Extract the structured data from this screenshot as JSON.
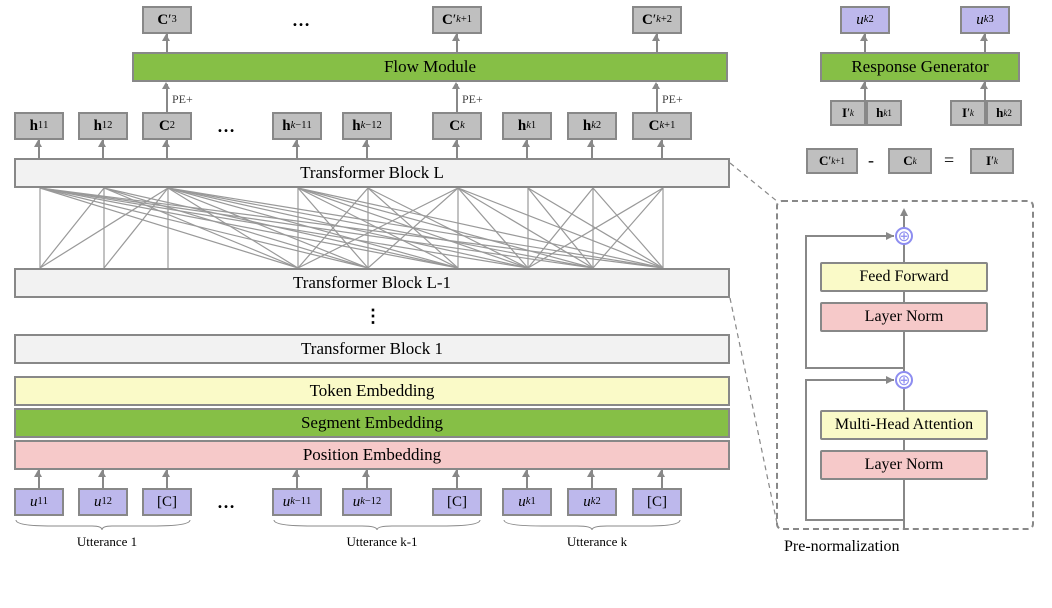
{
  "left": {
    "flow_label": "Flow Module",
    "pe_label": "PE+",
    "transformer_L": "Transformer Block L",
    "transformer_Lm1": "Transformer Block L-1",
    "transformer_1": "Transformer Block 1",
    "token_emb": "Token Embedding",
    "segment_emb": "Segment Embedding",
    "position_emb": "Position Embedding",
    "utt1": "Utterance 1",
    "uttkm1": "Utterance k-1",
    "uttk": "Utterance k",
    "dots": "…",
    "vdots": "⋮",
    "outputs": [
      {
        "html": "<b>C</b>′<sub>3</sub>"
      },
      {
        "html": "<b>C</b>′<sub><span class='mvar'>k</span>+1</sub>"
      },
      {
        "html": "<b>C</b>′<sub><span class='mvar'>k</span>+2</sub>"
      }
    ],
    "hidden_row": [
      {
        "html": "<b>h</b><sub>1</sub><sup>1</sup>"
      },
      {
        "html": "<b>h</b><sub>1</sub><sup>2</sup>"
      },
      {
        "html": "<b>C</b><sub>2</sub>"
      },
      {
        "html": "<b>h</b><sub><span class='mvar'>k</span>−1</sub><sup>1</sup>"
      },
      {
        "html": "<b>h</b><sub><span class='mvar'>k</span>−1</sub><sup>2</sup>"
      },
      {
        "html": "<b>C</b><sub><span class='mvar'>k</span></sub>"
      },
      {
        "html": "<b>h</b><sub><span class='mvar'>k</span></sub><sup>1</sup>"
      },
      {
        "html": "<b>h</b><sub><span class='mvar'>k</span></sub><sup>2</sup>"
      },
      {
        "html": "<b>C</b><sub><span class='mvar'>k</span>+1</sub>"
      }
    ],
    "input_row": [
      {
        "html": "<span class='mvar'>u</span><sub>1</sub><sup>1</sup>"
      },
      {
        "html": "<span class='mvar'>u</span><sub>1</sub><sup>2</sup>"
      },
      {
        "html": "[C]"
      },
      {
        "html": "<span class='mvar'>u</span><sub><span class='mvar'>k</span>−1</sub><sup>1</sup>"
      },
      {
        "html": "<span class='mvar'>u</span><sub><span class='mvar'>k</span>−1</sub><sup>2</sup>"
      },
      {
        "html": "[C]"
      },
      {
        "html": "<span class='mvar'>u</span><sub><span class='mvar'>k</span></sub><sup>1</sup>"
      },
      {
        "html": "<span class='mvar'>u</span><sub><span class='mvar'>k</span></sub><sup>2</sup>"
      },
      {
        "html": "[C]"
      }
    ]
  },
  "right": {
    "resp_gen": "Response Generator",
    "outputs": [
      {
        "html": "<span class='mvar'>u</span><sub><span class='mvar'>k</span></sub><sup>2</sup>"
      },
      {
        "html": "<span class='mvar'>u</span><sub><span class='mvar'>k</span></sub><sup>3</sup>"
      }
    ],
    "inputs": [
      {
        "html": "<b>I</b>′<sub><span class='mvar'>k</span></sub>"
      },
      {
        "html": "<b>h</b><sub><span class='mvar'>k</span></sub><sup>1</sup>"
      },
      {
        "html": "<b>I</b>′<sub><span class='mvar'>k</span></sub>"
      },
      {
        "html": "<b>h</b><sub><span class='mvar'>k</span></sub><sup>2</sup>"
      }
    ],
    "equation": {
      "a": "<b>C</b>′<sub><span class='mvar'>k</span>+1</sub>",
      "minus": "-",
      "b": "<b>C</b><sub><span class='mvar'>k</span></sub>",
      "eq": "=",
      "c": "<b>I</b>′<sub><span class='mvar'>k</span></sub>"
    },
    "feed_forward": "Feed Forward",
    "layer_norm": "Layer Norm",
    "mha": "Multi-Head Attention",
    "prenorm": "Pre-normalization"
  },
  "chart_data": {
    "type": "diagram",
    "description": "Transformer-based dialogue model architecture with L transformer blocks (pre-normalization), token/segment/position embeddings, a Flow Module consuming C tokens (with PE added), and a Response Generator using I'_k = C'_{k+1} - C_k concatenated with h_k hidden states.",
    "stack_bottom_to_top": [
      "Position Embedding",
      "Segment Embedding",
      "Token Embedding",
      "Transformer Block 1",
      "…",
      "Transformer Block L-1",
      "Transformer Block L"
    ],
    "input_tokens": [
      "u_1^1",
      "u_1^2",
      "[C]",
      "…",
      "u_{k-1}^1",
      "u_{k-1}^2",
      "[C]",
      "u_k^1",
      "u_k^2",
      "[C]"
    ],
    "hidden_tokens": [
      "h_1^1",
      "h_1^2",
      "C_2",
      "…",
      "h_{k-1}^1",
      "h_{k-1}^2",
      "C_k",
      "h_k^1",
      "h_k^2",
      "C_{k+1}"
    ],
    "flow_module_inputs": [
      "C_2",
      "C_k",
      "C_{k+1}"
    ],
    "flow_module_outputs": [
      "C'_3",
      "…",
      "C'_{k+1}",
      "C'_{k+2}"
    ],
    "pe_added_to_flow_inputs": true,
    "response_generator_inputs": [
      "I'_k ⊕ h_k^1",
      "I'_k ⊕ h_k^2"
    ],
    "response_generator_outputs": [
      "u_k^2",
      "u_k^3"
    ],
    "equation": "C'_{k+1} - C_k = I'_k",
    "prenorm_block": [
      "LayerNorm",
      "Multi-Head Attention",
      "residual add",
      "LayerNorm",
      "Feed Forward",
      "residual add"
    ]
  }
}
